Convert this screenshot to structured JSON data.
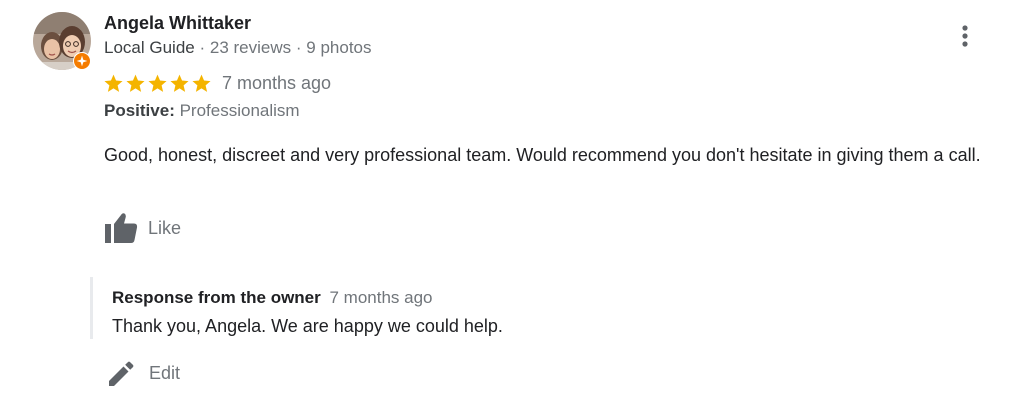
{
  "reviewer": {
    "name": "Angela Whittaker",
    "badge": "Local Guide",
    "reviews": "23 reviews",
    "photos": "9 photos",
    "separator": "·"
  },
  "review": {
    "rating": 5,
    "max_rating": 5,
    "star_color": "#f4b400",
    "time": "7 months ago",
    "positive_label": "Positive:",
    "positive_value": "Professionalism",
    "text": "Good, honest, discreet and very professional team. Would recommend you don't hesitate in giving them a call."
  },
  "actions": {
    "like_label": "Like",
    "like_icon": "thumbs-up-icon",
    "more_icon": "more-vert-icon"
  },
  "owner_response": {
    "title": "Response from the owner",
    "time": "7 months ago",
    "text": "Thank you, Angela. We are happy we could help.",
    "edit_label": "Edit",
    "edit_icon": "pencil-icon"
  },
  "colors": {
    "local_guide_badge": "#f57c00",
    "icon_gray": "#5f6368"
  }
}
